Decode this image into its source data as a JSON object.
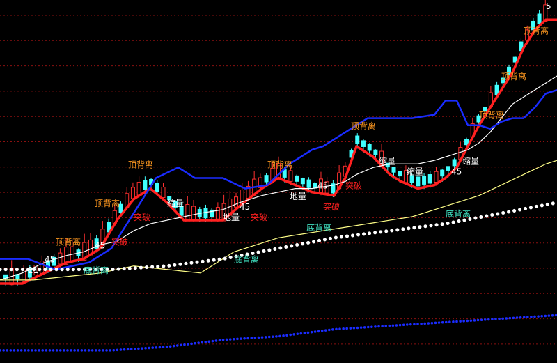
{
  "chart_data": {
    "type": "line",
    "title": "",
    "xlabel": "",
    "ylabel": "",
    "grid": true,
    "grid_style": "dashed-red-horizontal",
    "background": "#000000",
    "xlim": [
      0,
      100
    ],
    "ylim": [
      0,
      100
    ],
    "series": [
      {
        "color": "#ff2020",
        "x": [
          0,
          4,
          8,
          12,
          15,
          18,
          21,
          24,
          27,
          30,
          33,
          36,
          40,
          43,
          47,
          50,
          53,
          56,
          60,
          62,
          64,
          67,
          70,
          72,
          75,
          78,
          80,
          82,
          84,
          86,
          88,
          90,
          92,
          94,
          96,
          98,
          100
        ],
        "y": [
          21,
          21,
          24,
          27,
          28,
          31,
          39,
          45,
          48,
          44,
          39,
          39,
          39,
          43,
          48,
          51,
          49,
          47,
          46,
          51,
          60,
          57,
          52,
          50,
          48,
          49,
          51,
          54,
          60,
          66,
          71,
          76,
          81,
          88,
          93,
          96,
          96
        ]
      },
      {
        "color": "#ffffff",
        "x": [
          0,
          4,
          8,
          12,
          15,
          18,
          21,
          24,
          27,
          30,
          33,
          36,
          40,
          43,
          47,
          50,
          53,
          56,
          60,
          62,
          64,
          67,
          70,
          72,
          75,
          78,
          80,
          82,
          84,
          86,
          88,
          90,
          92,
          94,
          96,
          98,
          100
        ],
        "y": [
          22,
          24,
          27,
          29,
          30,
          32,
          33,
          36,
          38,
          39,
          40,
          41,
          42,
          44,
          46,
          47,
          48,
          48,
          49,
          50,
          52,
          54,
          55,
          55,
          55,
          56,
          57,
          58,
          59,
          61,
          64,
          68,
          72,
          74,
          76,
          78,
          80
        ]
      },
      {
        "color": "#1a2cff",
        "x": [
          0,
          5,
          10,
          16,
          20,
          24,
          28,
          32,
          35,
          40,
          44,
          48,
          52,
          56,
          58,
          60,
          62,
          64,
          66,
          70,
          74,
          78,
          80,
          82,
          84,
          86,
          88,
          90,
          92,
          94,
          96,
          98,
          100
        ],
        "y": [
          28,
          28,
          25,
          27,
          31,
          41,
          51,
          54,
          51,
          51,
          48,
          49,
          55,
          59,
          60,
          62,
          64,
          66,
          68,
          68,
          68,
          69,
          73,
          73,
          66,
          66,
          65,
          67,
          68,
          68,
          71,
          75,
          76
        ]
      },
      {
        "color": "#ffff88",
        "x": [
          0,
          6,
          12,
          18,
          24,
          30,
          36,
          42,
          46,
          50,
          54,
          58,
          62,
          66,
          70,
          74,
          78,
          82,
          86,
          90,
          94,
          98,
          100
        ],
        "y": [
          22,
          22,
          23,
          24,
          26,
          25,
          24,
          30,
          32,
          34,
          35,
          36,
          37,
          38,
          39,
          40,
          42,
          44,
          46,
          49,
          52,
          55,
          56
        ]
      },
      {
        "color": "#ffffff",
        "x": [
          0,
          10,
          20,
          30,
          40,
          50,
          60,
          70,
          80,
          90,
          100
        ],
        "y": [
          25,
          25,
          25,
          26,
          28,
          31,
          34,
          36,
          38,
          41,
          44
        ]
      },
      {
        "color": "#1a2cff",
        "x": [
          0,
          10,
          20,
          30,
          40,
          50,
          60,
          70,
          80,
          90,
          100
        ],
        "y": [
          2,
          2,
          2,
          3,
          5,
          6,
          8,
          9,
          10,
          11,
          12
        ]
      }
    ],
    "annotations": [
      {
        "text": "顶背离",
        "color": "#ff9920",
        "x": 23,
        "y": 54
      },
      {
        "text": "顶背离",
        "color": "#ff9920",
        "x": 48,
        "y": 54
      },
      {
        "text": "顶背离",
        "color": "#ff9920",
        "x": 63,
        "y": 65
      },
      {
        "text": "顶背离",
        "color": "#ff9920",
        "x": 17,
        "y": 43
      },
      {
        "text": "顶背离",
        "color": "#ff9920",
        "x": 10,
        "y": 32
      },
      {
        "text": "顶背离",
        "color": "#ff9920",
        "x": 86,
        "y": 68
      },
      {
        "text": "顶背离",
        "color": "#ff9920",
        "x": 90,
        "y": 79
      },
      {
        "text": "顶背离",
        "color": "#ff9920",
        "x": 94,
        "y": 92
      },
      {
        "text": "底背离",
        "color": "#40e0c0",
        "x": 15,
        "y": 24
      },
      {
        "text": "底背离",
        "color": "#40e0c0",
        "x": 42,
        "y": 27
      },
      {
        "text": "底背离",
        "color": "#40e0c0",
        "x": 55,
        "y": 36
      },
      {
        "text": "底背离",
        "color": "#40e0c0",
        "x": 80,
        "y": 40
      },
      {
        "text": "突破",
        "color": "#ff2020",
        "x": 24,
        "y": 39
      },
      {
        "text": "突破",
        "color": "#ff2020",
        "x": 20,
        "y": 32
      },
      {
        "text": "突破",
        "color": "#ff2020",
        "x": 45,
        "y": 39
      },
      {
        "text": "突破",
        "color": "#ff2020",
        "x": 58,
        "y": 42
      },
      {
        "text": "突破",
        "color": "#ff2020",
        "x": 62,
        "y": 48
      },
      {
        "text": "缩量",
        "color": "#ffffff",
        "x": 30,
        "y": 43
      },
      {
        "text": "缩量",
        "color": "#ffffff",
        "x": 68,
        "y": 55
      },
      {
        "text": "缩量",
        "color": "#ffffff",
        "x": 73,
        "y": 52
      },
      {
        "text": "缩量",
        "color": "#ffffff",
        "x": 83,
        "y": 55
      },
      {
        "text": "地量",
        "color": "#ffffff",
        "x": 40,
        "y": 39
      },
      {
        "text": "地量",
        "color": "#ffffff",
        "x": 52,
        "y": 45
      },
      {
        "text": "45",
        "color": "#ffffff",
        "x": 8,
        "y": 27
      },
      {
        "text": "45",
        "color": "#ffffff",
        "x": 17,
        "y": 31
      },
      {
        "text": "45",
        "color": "#ffffff",
        "x": 43,
        "y": 42
      },
      {
        "text": "45",
        "color": "#ffffff",
        "x": 57,
        "y": 48
      },
      {
        "text": "45",
        "color": "#ffffff",
        "x": 81,
        "y": 52
      },
      {
        "text": "21",
        "color": "#ffffff",
        "x": 5,
        "y": 24
      },
      {
        "text": "5",
        "color": "#ffffff",
        "x": 98,
        "y": 99
      }
    ]
  }
}
